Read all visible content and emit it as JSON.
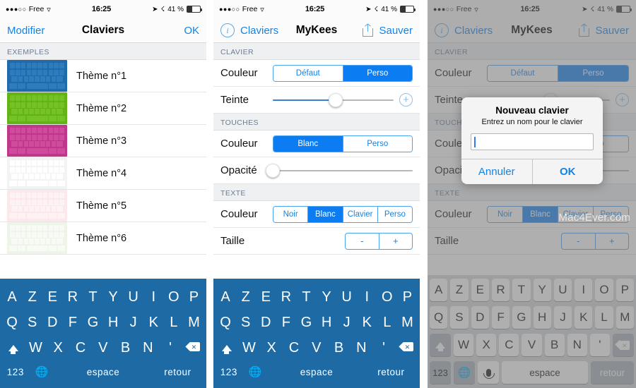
{
  "status_bar": {
    "signal_dots": "●●●○○",
    "carrier": "Free",
    "wifi_icon": "wifi-icon",
    "time": "16:25",
    "location_icon": "location-arrow-icon",
    "bluetooth_icon": "bluetooth-icon",
    "battery_text": "41 %",
    "battery_percent": 41
  },
  "panel1": {
    "nav": {
      "left_label": "Modifier",
      "title": "Claviers",
      "right_label": "OK"
    },
    "section_header": "EXEMPLES",
    "themes": [
      {
        "label": "Thème n°1",
        "bg": "#1f6aa8",
        "key": "#2e7cbd",
        "text": "#bfd9ee"
      },
      {
        "label": "Thème n°2",
        "bg": "#63b315",
        "key": "#74c225",
        "text": "#d4eeb6"
      },
      {
        "label": "Thème n°3",
        "bg": "#c0368d",
        "key": "#cf4c9d",
        "text": "#f1c9e3"
      },
      {
        "label": "Thème n°4",
        "bg": "#f3f3f3",
        "key": "#ffffff",
        "text": "#6f6f6f"
      },
      {
        "label": "Thème n°5",
        "bg": "#fce7ea",
        "key": "#fdf3f5",
        "text": "#cf7f90"
      },
      {
        "label": "Thème n°6",
        "bg": "#eef4e8",
        "key": "#f8fbf5",
        "text": "#7f9a6e"
      }
    ]
  },
  "panel2": {
    "nav": {
      "info_icon": "info-icon",
      "back_label": "Claviers",
      "title": "MyKees",
      "share_icon": "share-icon",
      "right_label": "Sauver"
    },
    "sections": [
      {
        "header": "CLAVIER",
        "rows": [
          {
            "type": "segmented",
            "label": "Couleur",
            "options": [
              "Défaut",
              "Perso"
            ],
            "selected": 1
          },
          {
            "type": "slider",
            "label": "Teinte",
            "value": 52,
            "filled": true,
            "plus_button": "+"
          }
        ]
      },
      {
        "header": "TOUCHES",
        "rows": [
          {
            "type": "segmented",
            "label": "Couleur",
            "options": [
              "Blanc",
              "Perso"
            ],
            "selected": 0
          },
          {
            "type": "slider",
            "label": "Opacité",
            "value": 0,
            "filled": false
          }
        ]
      },
      {
        "header": "TEXTE",
        "rows": [
          {
            "type": "segmented",
            "label": "Couleur",
            "options": [
              "Noir",
              "Blanc",
              "Clavier",
              "Perso"
            ],
            "selected": 1
          },
          {
            "type": "stepper",
            "label": "Taille",
            "options": [
              "-",
              "+"
            ]
          }
        ]
      }
    ]
  },
  "panel3": {
    "watermark": "Mac4Ever.com",
    "dialog": {
      "title": "Nouveau clavier",
      "message": "Entrez un nom pour le clavier",
      "input_value": "",
      "cancel_label": "Annuler",
      "ok_label": "OK"
    }
  },
  "keyboard": {
    "row1": [
      "A",
      "Z",
      "E",
      "R",
      "T",
      "Y",
      "U",
      "I",
      "O",
      "P"
    ],
    "row2": [
      "Q",
      "S",
      "D",
      "F",
      "G",
      "H",
      "J",
      "K",
      "L",
      "M"
    ],
    "row3": [
      "W",
      "X",
      "C",
      "V",
      "B",
      "N",
      "'"
    ],
    "shift_icon": "shift-icon",
    "delete_icon": "delete-icon",
    "numeric_label": "123",
    "globe_icon": "globe-icon",
    "mic_icon": "microphone-icon",
    "space_label": "espace",
    "return_label": "retour"
  }
}
